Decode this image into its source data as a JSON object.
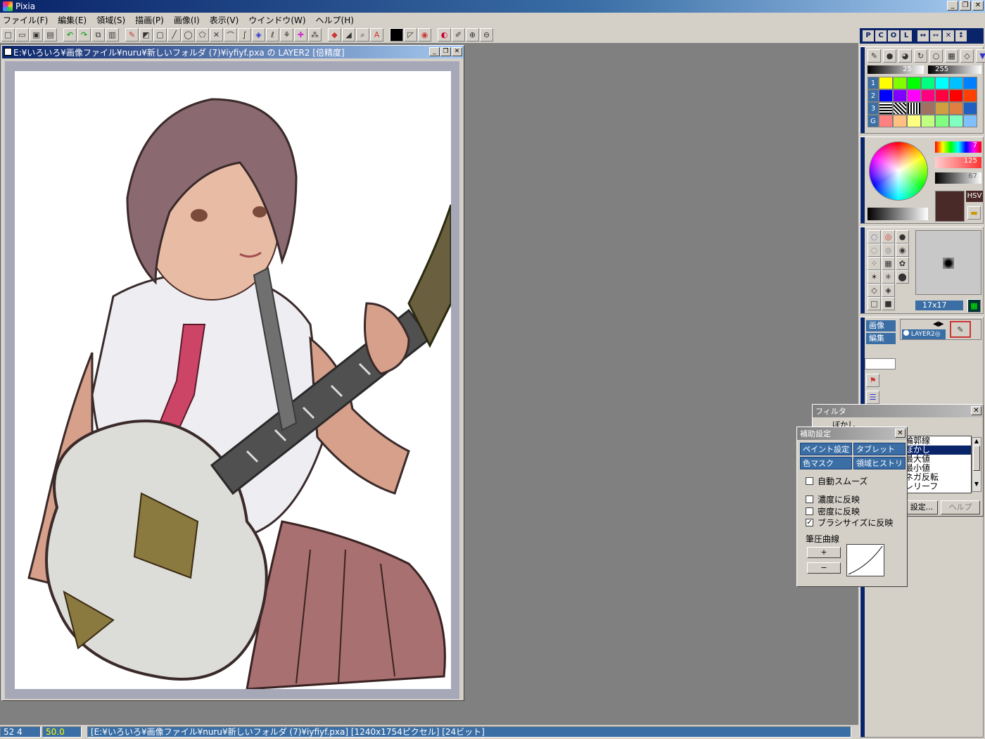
{
  "app": {
    "title": "Pixia"
  },
  "window_buttons": {
    "minimize": "_",
    "restore": "❐",
    "close": "✕"
  },
  "menu": [
    "ファイル(F)",
    "編集(E)",
    "領域(S)",
    "描画(P)",
    "画像(I)",
    "表示(V)",
    "ウインドウ(W)",
    "ヘルプ(H)"
  ],
  "document": {
    "title": "E:¥いろいろ¥画像ファイル¥nuru¥新しいフォルダ (7)¥iyfiyf.pxa の LAYER2 [倍精度]"
  },
  "palette_header": {
    "buttons": [
      "P",
      "C",
      "O",
      "L"
    ]
  },
  "palette": {
    "brightness_value": "25",
    "density_value": "255",
    "row_labels": [
      "1",
      "2",
      "3",
      "G"
    ],
    "rows": [
      [
        "#ffff00",
        "#80ff00",
        "#00ff00",
        "#00ff80",
        "#00ffff",
        "#00c0ff",
        "#0080ff"
      ],
      [
        "#0000ff",
        "#8000ff",
        "#ff00ff",
        "#ff0080",
        "#ff0040",
        "#ff0000",
        "#ff4000"
      ],
      [
        "#c0c0c0",
        "#808080",
        "#404040",
        "#a07060",
        "#d0a040",
        "#e08040",
        "#2060c0"
      ],
      [
        "#ff8080",
        "#ffc080",
        "#ffff80",
        "#c0ff80",
        "#80ff80",
        "#80ffc0",
        "#80c0ff"
      ]
    ]
  },
  "color_picker": {
    "hue": "7",
    "saturation": "125",
    "value": "67",
    "mode": "HSV",
    "current_color": "#4a2a28"
  },
  "brush": {
    "size_label": "17x17"
  },
  "layer_panel": {
    "image_tab": "画像",
    "edit_tab": "編集",
    "layer_name": "LAYER2◎"
  },
  "filter_dialog": {
    "title": "フィルタ",
    "category": "ぼかし",
    "items": [
      "輪郭線",
      "ぼかし",
      "最大値",
      "最小値",
      "ネガ反転",
      "レリーフ"
    ],
    "selected_index": 1,
    "settings_button": "設定...",
    "help_button": "ヘルプ"
  },
  "aux_dialog": {
    "title": "補助設定",
    "tabs": [
      "ペイント設定",
      "タブレット",
      "色マスク",
      "領域ヒストリ"
    ],
    "checks": [
      {
        "label": "自動スムーズ",
        "checked": false
      },
      {
        "label": "濃度に反映",
        "checked": false
      },
      {
        "label": "密度に反映",
        "checked": false
      },
      {
        "label": "ブラシサイズに反映",
        "checked": true
      }
    ],
    "curve_label": "筆圧曲線",
    "plus": "+",
    "minus": "−"
  },
  "status": {
    "coords": "52  4",
    "zoom": "50.0",
    "path": "[E:¥いろいろ¥画像ファイル¥nuru¥新しいフォルダ (7)¥iyfiyf.pxa] [1240x1754ピクセル] [24ビット]"
  }
}
